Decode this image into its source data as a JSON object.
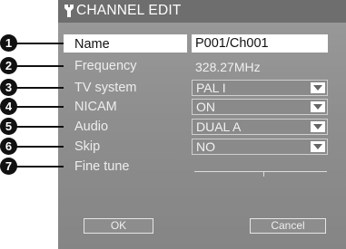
{
  "title": "CHANNEL EDIT",
  "badges": [
    "1",
    "2",
    "3",
    "4",
    "5",
    "6",
    "7"
  ],
  "fields": {
    "name": {
      "label": "Name",
      "value": "P001/Ch001"
    },
    "frequency": {
      "label": "Frequency",
      "value": "328.27MHz"
    },
    "tv_system": {
      "label": "TV system",
      "value": "PAL  I"
    },
    "nicam": {
      "label": "NICAM",
      "value": "ON"
    },
    "audio": {
      "label": "Audio",
      "value": "DUAL  A"
    },
    "skip": {
      "label": "Skip",
      "value": "NO"
    },
    "fine_tune": {
      "label": "Fine tune"
    }
  },
  "buttons": {
    "ok": "OK",
    "cancel": "Cancel"
  }
}
